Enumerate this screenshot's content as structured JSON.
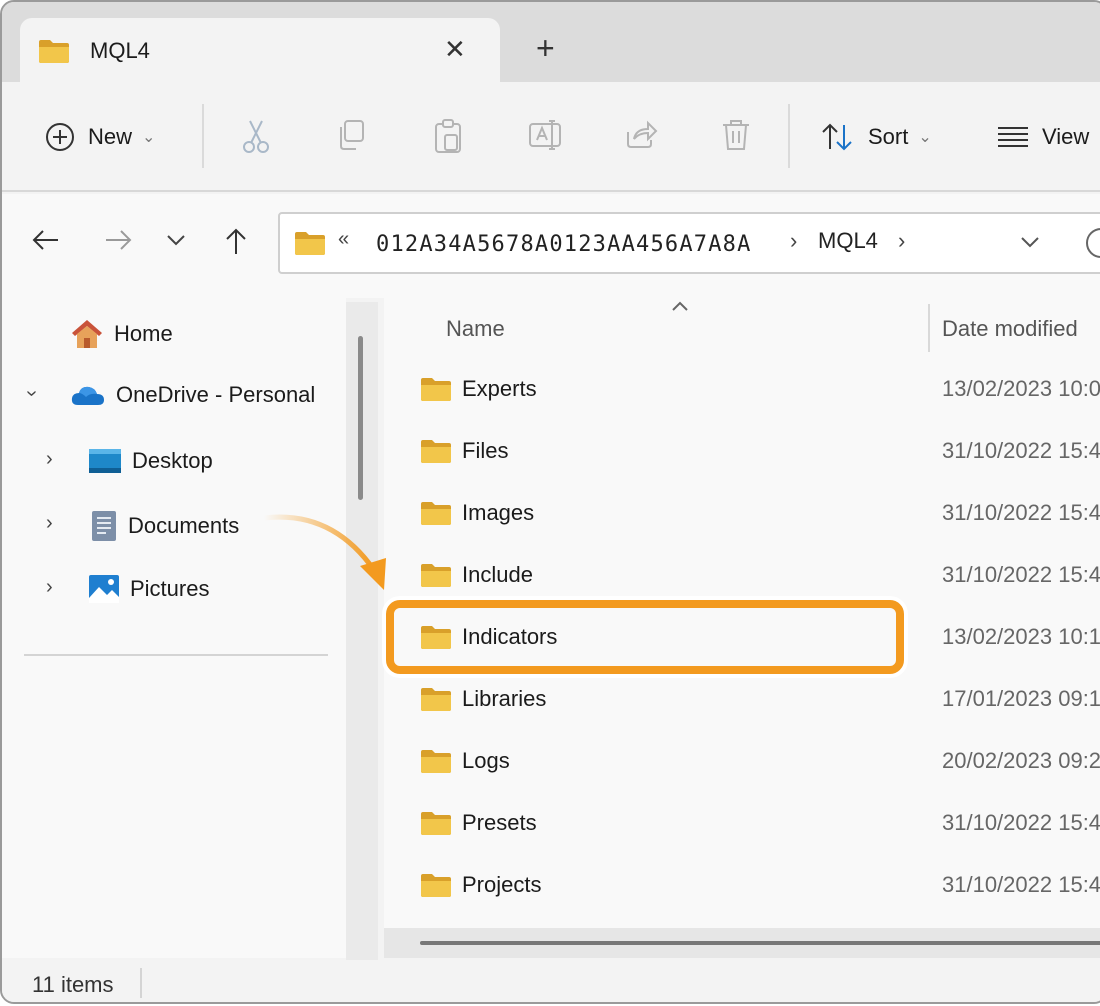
{
  "tab": {
    "title": "MQL4",
    "close_glyph": "✕",
    "add_glyph": "+"
  },
  "toolbar": {
    "new_label": "New",
    "sort_label": "Sort",
    "view_label": "View",
    "dropdown_glyph": "⌄"
  },
  "address": {
    "more_glyph": "«",
    "crumbs": [
      "012A34A5678A0123AA456A7A8A",
      "MQL4"
    ],
    "sep_glyph": "›"
  },
  "sidebar": {
    "home_label": "Home",
    "onedrive_label": "OneDrive - Personal",
    "desktop_label": "Desktop",
    "documents_label": "Documents",
    "pictures_label": "Pictures",
    "expand_glyph": "›",
    "collapse_glyph": "⌄"
  },
  "columns": {
    "name": "Name",
    "date": "Date modified"
  },
  "files": [
    {
      "name": "Experts",
      "date": "13/02/2023 10:0"
    },
    {
      "name": "Files",
      "date": "31/10/2022 15:4"
    },
    {
      "name": "Images",
      "date": "31/10/2022 15:4"
    },
    {
      "name": "Include",
      "date": "31/10/2022 15:4"
    },
    {
      "name": "Indicators",
      "date": "13/02/2023 10:1"
    },
    {
      "name": "Libraries",
      "date": "17/01/2023 09:1"
    },
    {
      "name": "Logs",
      "date": "20/02/2023 09:2"
    },
    {
      "name": "Presets",
      "date": "31/10/2022 15:4"
    },
    {
      "name": "Projects",
      "date": "31/10/2022 15:4"
    }
  ],
  "status": {
    "items": "11 items"
  },
  "colors": {
    "highlight": "#f39a1f",
    "folder": "#e8b73c",
    "accent": "#1a73c8"
  }
}
